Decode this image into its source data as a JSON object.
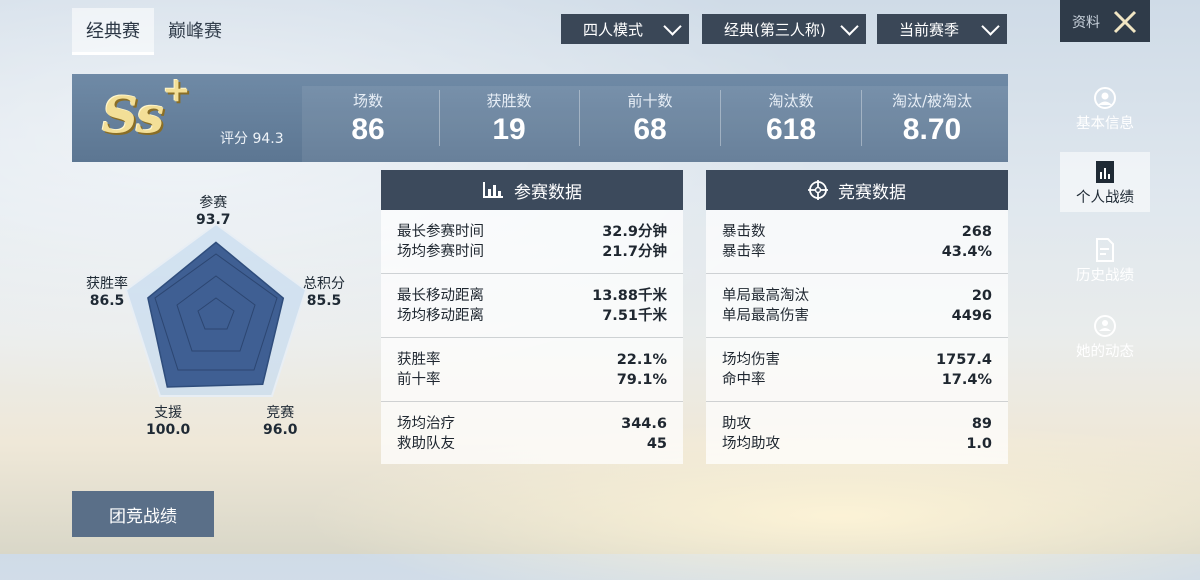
{
  "top_tabs": [
    {
      "label": "经典赛"
    },
    {
      "label": "巅峰赛"
    }
  ],
  "filters": {
    "mode": "四人模式",
    "view": "经典(第三人称)",
    "season": "当前赛季"
  },
  "summary": {
    "rank": "SS+",
    "rank_main": "Ss",
    "rank_plus": "+",
    "rating": "评分 94.3",
    "stats": [
      {
        "label": "场数",
        "value": "86"
      },
      {
        "label": "获胜数",
        "value": "19"
      },
      {
        "label": "前十数",
        "value": "68"
      },
      {
        "label": "淘汰数",
        "value": "618"
      },
      {
        "label": "淘汰/被淘汰",
        "value": "8.70"
      }
    ]
  },
  "radar": {
    "axes": [
      {
        "label": "参赛",
        "value": "93.7"
      },
      {
        "label": "总积分",
        "value": "85.5"
      },
      {
        "label": "竞赛",
        "value": "96.0"
      },
      {
        "label": "支援",
        "value": "100.0"
      },
      {
        "label": "获胜率",
        "value": "86.5"
      }
    ]
  },
  "participation": {
    "title": "参赛数据",
    "icon": "bar-chart-icon",
    "groups": [
      [
        {
          "label": "最长参赛时间",
          "value": "32.9分钟"
        },
        {
          "label": "场均参赛时间",
          "value": "21.7分钟"
        }
      ],
      [
        {
          "label": "最长移动距离",
          "value": "13.88千米"
        },
        {
          "label": "场均移动距离",
          "value": "7.51千米"
        }
      ],
      [
        {
          "label": "获胜率",
          "value": "22.1%"
        },
        {
          "label": "前十率",
          "value": "79.1%"
        }
      ],
      [
        {
          "label": "场均治疗",
          "value": "344.6"
        },
        {
          "label": "救助队友",
          "value": "45"
        }
      ]
    ]
  },
  "competition": {
    "title": "竞赛数据",
    "icon": "crosshair-icon",
    "groups": [
      [
        {
          "label": "暴击数",
          "value": "268"
        },
        {
          "label": "暴击率",
          "value": "43.4%"
        }
      ],
      [
        {
          "label": "单局最高淘汰",
          "value": "20"
        },
        {
          "label": "单局最高伤害",
          "value": "4496"
        }
      ],
      [
        {
          "label": "场均伤害",
          "value": "1757.4"
        },
        {
          "label": "命中率",
          "value": "17.4%"
        }
      ],
      [
        {
          "label": "助攻",
          "value": "89"
        },
        {
          "label": "场均助攻",
          "value": "1.0"
        }
      ]
    ]
  },
  "sidebar": {
    "header_label": "资料",
    "items": [
      {
        "label": "基本信息",
        "icon": "profile-icon"
      },
      {
        "label": "个人战绩",
        "icon": "stats-document-icon"
      },
      {
        "label": "历史战绩",
        "icon": "history-document-icon"
      },
      {
        "label": "她的动态",
        "icon": "activity-icon"
      }
    ]
  },
  "team_button": "团竞战绩",
  "colors": {
    "panel_header": "#3c4a5c",
    "summary_band": "#6684a2",
    "radar_fill": "#3f5f93",
    "rank_gold": "#f3df97"
  }
}
